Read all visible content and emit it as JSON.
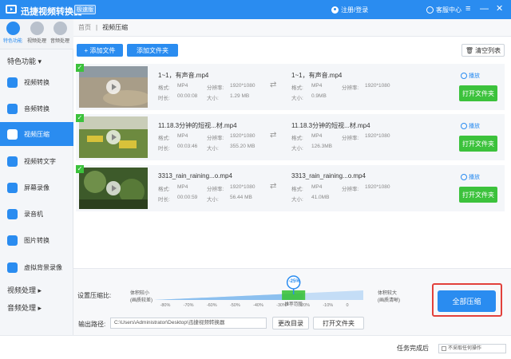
{
  "app": {
    "title": "迅捷视频转换器",
    "edition_badge": "极速版",
    "login_text": "注册/登录",
    "help_text": "客服中心",
    "controls": {
      "menu": "≡",
      "minimize": "—",
      "close": "✕"
    }
  },
  "top_icons": [
    {
      "label": "特色功能",
      "active": true
    },
    {
      "label": "视频处理",
      "active": false
    },
    {
      "label": "音频处理",
      "active": false
    }
  ],
  "sidebar": {
    "section_feature": "特色功能 ▾",
    "items": [
      {
        "label": "视频转换",
        "icon": "video-convert-icon",
        "active": false
      },
      {
        "label": "音频转换",
        "icon": "audio-convert-icon",
        "active": false
      },
      {
        "label": "视频压缩",
        "icon": "video-compress-icon",
        "active": true
      },
      {
        "label": "视频转文字",
        "icon": "video-to-text-icon",
        "active": false
      },
      {
        "label": "屏幕录像",
        "icon": "screen-record-icon",
        "active": false
      },
      {
        "label": "录音机",
        "icon": "recorder-icon",
        "active": false
      },
      {
        "label": "图片转换",
        "icon": "image-convert-icon",
        "active": false
      },
      {
        "label": "虚拟背景录像",
        "icon": "virtual-bg-icon",
        "active": false
      }
    ],
    "section_video": "视频处理 ▸",
    "section_audio": "音频处理 ▸"
  },
  "breadcrumb": {
    "home": "首页",
    "sep": "|",
    "current": "视频压缩"
  },
  "toolbar": {
    "add_file": "+ 添加文件",
    "add_folder": "添加文件夹",
    "clear_list": "清空列表"
  },
  "labels": {
    "format": "格式:",
    "resolution": "分辨率:",
    "duration": "时长:",
    "size": "大小:",
    "play": "播放",
    "open_folder": "打开文件夹"
  },
  "files": [
    {
      "name": "1~1，有声音.mp4",
      "format": "MP4",
      "resolution": "1920*1080",
      "duration": "00:00:08",
      "size": "1.29 MB",
      "out_name": "1~1，有声音.mp4",
      "out_format": "MP4",
      "out_resolution": "1920*1080",
      "out_size": "0.9MB"
    },
    {
      "name": "11.18.3分钟的短视...材.mp4",
      "format": "MP4",
      "resolution": "1920*1080",
      "duration": "00:03:46",
      "size": "355.20 MB",
      "out_name": "11.18.3分钟的短视...材.mp4",
      "out_format": "MP4",
      "out_resolution": "1920*1080",
      "out_size": "126.3MB"
    },
    {
      "name": "3313_rain_raining...o.mp4",
      "format": "MP4",
      "resolution": "1920*1080",
      "duration": "00:00:59",
      "size": "56.44 MB",
      "out_name": "3313_rain_raining...o.mp4",
      "out_format": "MP4",
      "out_resolution": "1920*1080",
      "out_size": "41.0MB"
    }
  ],
  "compression": {
    "label": "设置压缩比:",
    "small_size": "体积较小",
    "small_quality": "(画质较差)",
    "large_size": "体积较大",
    "large_quality": "(画质清晰)",
    "value_label": "-25%",
    "value": -25,
    "recommended": "推荐范围",
    "ticks": [
      "-80%",
      "-70%",
      "-60%",
      "-50%",
      "-40%",
      "-30%",
      "-20%",
      "-10%",
      "0"
    ]
  },
  "output": {
    "label": "输出路径:",
    "path": "C:\\Users\\Administrator\\Desktop\\迅捷视频转换器",
    "change_dir": "更改目录",
    "open_folder": "打开文件夹"
  },
  "compress_all": "全部压缩",
  "status": {
    "after_done_label": "任务完成后",
    "after_done_value": "不采取任何操作"
  }
}
